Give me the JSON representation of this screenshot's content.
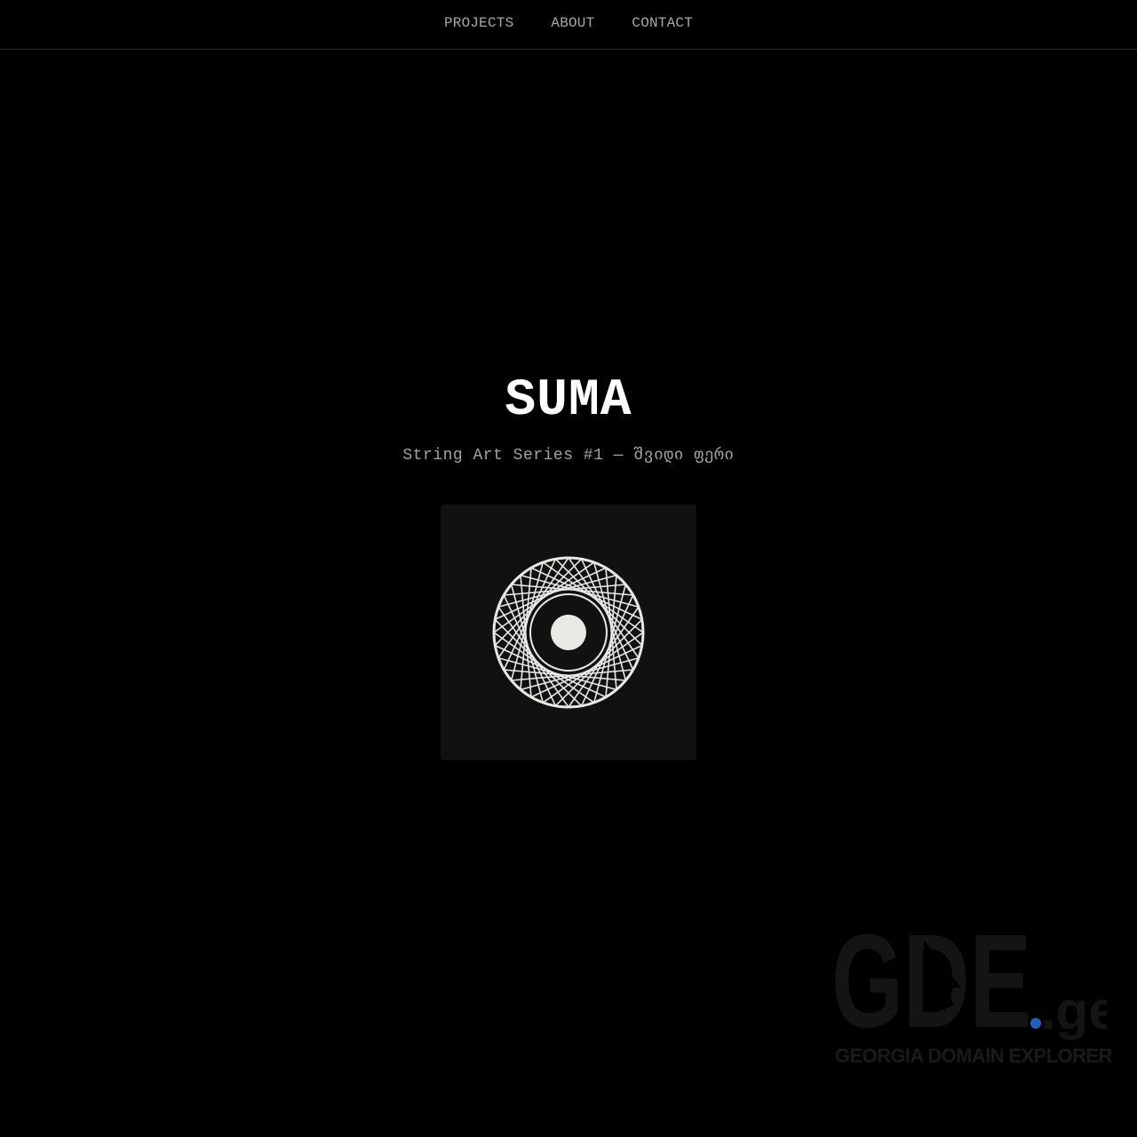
{
  "nav": {
    "items": [
      "PROJECTS",
      "ABOUT",
      "CONTACT"
    ]
  },
  "hero": {
    "title": "SUMA",
    "subtitle": "String Art Series #1 — შვიდი ფერი"
  },
  "artwork": {
    "icon": "string-art-circle",
    "colors": {
      "card_background": "#111111",
      "string": "#e8e8e4",
      "inner_ring": "#111111",
      "center_dot": "#e8e8e4"
    }
  },
  "watermark": {
    "logo_text": "GDE",
    "tld_text": ".ge",
    "caption": "GEORGIA DOMAIN EXPLORER",
    "colors": {
      "logo": "#141414",
      "dot": "#1f5fbf"
    }
  },
  "colors": {
    "background": "#000000",
    "nav_text": "#a8a8a8",
    "title": "#ffffff",
    "subtitle": "#a3a3a3"
  }
}
